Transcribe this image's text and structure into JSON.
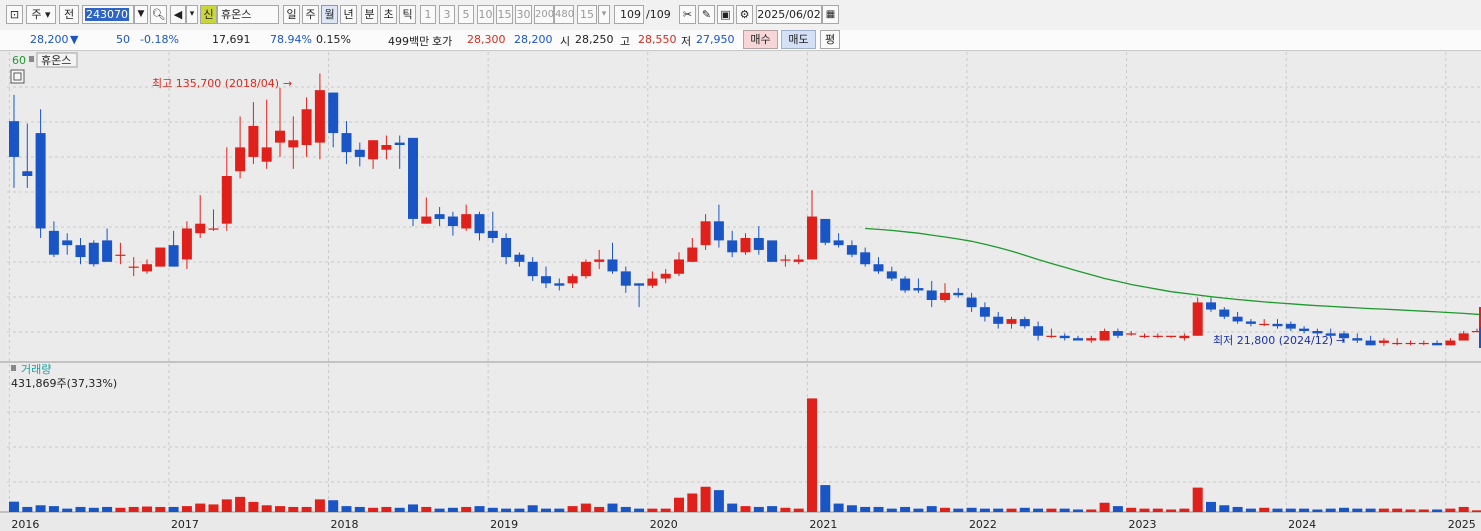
{
  "toolbar": {
    "stock_mode": "주",
    "prev_label": "전",
    "code": "243070",
    "sin_label": "신",
    "name": "휴온스",
    "periods": [
      "일",
      "주",
      "월",
      "년",
      "분",
      "초",
      "틱"
    ],
    "active_period": "월",
    "intervals": [
      "1",
      "3",
      "5",
      "10",
      "15",
      "30",
      "200",
      "480"
    ],
    "count": "15",
    "page": "109",
    "page_total": "/109",
    "date": "2025/06/02"
  },
  "quote": {
    "price": "28,200",
    "change_arrow": "▼",
    "change": "50",
    "change_pct": "-0.18%",
    "volume": "17,691",
    "vol_ratio": "78.94%",
    "turnover": "0.15%",
    "amount": "499백만",
    "hoga_label": "호가",
    "ask": "28,300",
    "bid": "28,200",
    "open_label": "시",
    "open": "28,250",
    "high_label": "고",
    "high": "28,550",
    "low_label": "저",
    "low": "27,950",
    "buy_label": "매수",
    "sell_label": "매도",
    "eval_label": "평"
  },
  "chart_data": {
    "type": "candlestick",
    "ma_label": "60",
    "name_tag": "휴온스",
    "ylim": [
      15000,
      145000
    ],
    "max_annotation": "최고 135,700 (2018/04)",
    "min_annotation": "최저 21,800 (2024/12)",
    "volume_label": "거래량",
    "volume_value": "431,869주(37,33%)",
    "volume_max": 1450000,
    "x_labels": [
      "2016",
      "2017",
      "2018",
      "2019",
      "2020",
      "2021",
      "2022",
      "2023",
      "2024",
      "2025"
    ],
    "x_label_months": [
      0,
      12,
      24,
      36,
      48,
      60,
      72,
      84,
      96,
      108
    ],
    "candles": [
      [
        116,
        127,
        101,
        88,
        123000
      ],
      [
        95,
        115,
        93,
        88,
        60000
      ],
      [
        111,
        121,
        71,
        67,
        80000
      ],
      [
        70,
        74,
        60,
        59,
        70000
      ],
      [
        66,
        69,
        64,
        60,
        40000
      ],
      [
        64,
        67,
        59,
        56,
        60000
      ],
      [
        65,
        66,
        56,
        55,
        50000
      ],
      [
        66,
        71,
        57,
        57,
        60000
      ],
      [
        60,
        65,
        60,
        56,
        50000
      ],
      [
        55,
        59,
        55,
        51,
        60000
      ],
      [
        53,
        58,
        56,
        52,
        65000
      ],
      [
        55,
        61,
        63,
        55,
        60000
      ],
      [
        64,
        70,
        55,
        55,
        60000
      ],
      [
        58,
        74,
        71,
        54,
        70000
      ],
      [
        69,
        85,
        73,
        67,
        100000
      ],
      [
        71,
        79,
        71,
        70,
        90000
      ],
      [
        73,
        105,
        93,
        70,
        150000
      ],
      [
        95,
        118,
        105,
        92,
        180000
      ],
      [
        101,
        124,
        114,
        98,
        120000
      ],
      [
        99,
        125,
        105,
        96,
        80000
      ],
      [
        107,
        130,
        112,
        101,
        70000
      ],
      [
        105,
        118,
        108,
        96,
        60000
      ],
      [
        106,
        126,
        121,
        101,
        60000
      ],
      [
        107,
        136,
        129,
        100,
        150000
      ],
      [
        128,
        126,
        111,
        105,
        140000
      ],
      [
        111,
        116,
        103,
        98,
        70000
      ],
      [
        104,
        107,
        101,
        97,
        60000
      ],
      [
        100,
        108,
        108,
        96,
        50000
      ],
      [
        104,
        110,
        106,
        100,
        60000
      ],
      [
        107,
        110,
        106,
        96,
        50000
      ],
      [
        109,
        107,
        75,
        72,
        90000
      ],
      [
        73,
        84,
        76,
        73,
        60000
      ],
      [
        77,
        80,
        75,
        72,
        40000
      ],
      [
        76,
        78,
        72,
        68,
        50000
      ],
      [
        71,
        81,
        77,
        70,
        60000
      ],
      [
        77,
        78,
        69,
        66,
        70000
      ],
      [
        70,
        78,
        67,
        65,
        50000
      ],
      [
        67,
        69,
        59,
        56,
        40000
      ],
      [
        60,
        61,
        57,
        55,
        40000
      ],
      [
        57,
        59,
        51,
        49,
        80000
      ],
      [
        51,
        55,
        48,
        46,
        40000
      ],
      [
        48,
        50,
        47,
        45,
        40000
      ],
      [
        48,
        52,
        51,
        46,
        70000
      ],
      [
        51,
        58,
        57,
        50,
        100000
      ],
      [
        57,
        62,
        58,
        54,
        60000
      ],
      [
        58,
        65,
        53,
        52,
        100000
      ],
      [
        53,
        55,
        47,
        44,
        60000
      ],
      [
        48,
        48,
        47,
        38,
        40000
      ],
      [
        47,
        53,
        50,
        46,
        40000
      ],
      [
        50,
        54,
        52,
        48,
        40000
      ],
      [
        52,
        61,
        58,
        51,
        170000
      ],
      [
        57,
        67,
        63,
        57,
        220000
      ],
      [
        64,
        77,
        74,
        62,
        300000
      ],
      [
        74,
        81,
        66,
        63,
        260000
      ],
      [
        66,
        70,
        61,
        59,
        100000
      ],
      [
        61,
        69,
        67,
        60,
        70000
      ],
      [
        67,
        72,
        62,
        60,
        60000
      ],
      [
        66,
        64,
        57,
        57,
        70000
      ],
      [
        58,
        60,
        58,
        55,
        50000
      ],
      [
        57,
        60,
        58,
        56,
        40000
      ],
      [
        58,
        87,
        76,
        58,
        1350000
      ],
      [
        75,
        75,
        65,
        64,
        320000
      ],
      [
        66,
        69,
        64,
        63,
        100000
      ],
      [
        64,
        66,
        60,
        59,
        80000
      ],
      [
        61,
        63,
        56,
        55,
        60000
      ],
      [
        56,
        59,
        53,
        52,
        60000
      ],
      [
        53,
        55,
        50,
        49,
        40000
      ],
      [
        50,
        51,
        45,
        44,
        60000
      ],
      [
        46,
        50,
        45,
        44,
        40000
      ],
      [
        45,
        49,
        41,
        38,
        70000
      ],
      [
        41,
        48,
        44,
        40,
        50000
      ],
      [
        44,
        46,
        43,
        42,
        40000
      ],
      [
        42,
        44,
        38,
        36,
        50000
      ],
      [
        38,
        40,
        34,
        32,
        40000
      ],
      [
        34,
        36,
        31,
        29,
        40000
      ],
      [
        31,
        34,
        33,
        29,
        40000
      ],
      [
        33,
        34,
        30,
        29,
        50000
      ],
      [
        30,
        32,
        26,
        24,
        40000
      ],
      [
        26,
        29,
        26,
        25,
        40000
      ],
      [
        26,
        27,
        25,
        24,
        40000
      ],
      [
        25,
        26,
        24,
        24,
        30000
      ],
      [
        24,
        26,
        25,
        23,
        30000
      ],
      [
        24,
        29,
        28,
        24,
        110000
      ],
      [
        28,
        29,
        26,
        25,
        70000
      ],
      [
        27,
        28,
        27,
        26,
        50000
      ],
      [
        26,
        27,
        26,
        25,
        40000
      ],
      [
        26,
        27,
        26,
        25,
        40000
      ],
      [
        26,
        26,
        26,
        25,
        30000
      ],
      [
        25,
        27,
        26,
        24,
        40000
      ],
      [
        26,
        42,
        40,
        26,
        290000
      ],
      [
        40,
        42,
        37,
        36,
        120000
      ],
      [
        37,
        38,
        34,
        33,
        80000
      ],
      [
        34,
        36,
        32,
        31,
        60000
      ],
      [
        32,
        33,
        31,
        30,
        40000
      ],
      [
        31,
        33,
        31,
        30,
        50000
      ],
      [
        31,
        33,
        30,
        29,
        40000
      ],
      [
        31,
        32,
        29,
        28,
        40000
      ],
      [
        29,
        30,
        28,
        27,
        40000
      ],
      [
        28,
        29,
        27,
        26,
        30000
      ],
      [
        27,
        29,
        26,
        25,
        40000
      ],
      [
        27,
        28,
        25,
        23,
        50000
      ],
      [
        25,
        27,
        24,
        23,
        40000
      ],
      [
        24,
        26,
        22,
        22,
        40000
      ],
      [
        23,
        25,
        24,
        21.8,
        40000
      ],
      [
        23,
        25,
        23,
        22,
        40000
      ],
      [
        23,
        24,
        23,
        22,
        30000
      ],
      [
        23,
        24,
        23,
        22,
        30000
      ],
      [
        23,
        24,
        22,
        22,
        30000
      ],
      [
        22,
        25,
        24,
        22,
        40000
      ],
      [
        24,
        28,
        27,
        24,
        60000
      ],
      [
        28,
        29,
        28,
        28,
        20000
      ]
    ],
    "ma_values": [
      [
        64,
        71
      ],
      [
        65,
        70.6
      ],
      [
        66,
        70.2
      ],
      [
        67,
        69.6
      ],
      [
        68,
        69.0
      ],
      [
        69,
        68.2
      ],
      [
        70,
        67.4
      ],
      [
        71,
        66.6
      ],
      [
        72,
        65.6
      ],
      [
        73,
        64.4
      ],
      [
        74,
        63.0
      ],
      [
        75,
        61.5
      ],
      [
        76,
        59.8
      ],
      [
        77,
        58.0
      ],
      [
        78,
        56.3
      ],
      [
        79,
        54.7
      ],
      [
        80,
        53.1
      ],
      [
        81,
        51.6
      ],
      [
        82,
        50.0
      ],
      [
        83,
        48.8
      ],
      [
        84,
        47.5
      ],
      [
        85,
        46.5
      ],
      [
        86,
        45.5
      ],
      [
        87,
        44.5
      ],
      [
        88,
        43.8
      ],
      [
        89,
        43.1
      ],
      [
        90,
        42.4
      ],
      [
        91,
        41.8
      ],
      [
        92,
        41.2
      ],
      [
        93,
        40.7
      ],
      [
        94,
        40.2
      ],
      [
        95,
        39.8
      ],
      [
        96,
        39.4
      ],
      [
        97,
        39.0
      ],
      [
        98,
        38.6
      ],
      [
        99,
        38.3
      ],
      [
        100,
        38.0
      ],
      [
        101,
        37.7
      ],
      [
        102,
        37.4
      ],
      [
        103,
        37.2
      ],
      [
        104,
        36.9
      ],
      [
        105,
        36.6
      ],
      [
        106,
        36.3
      ],
      [
        107,
        36.0
      ],
      [
        108,
        35.7
      ],
      [
        109,
        35.4
      ],
      [
        110,
        35.0
      ],
      [
        111,
        34.6
      ]
    ]
  },
  "colors": {
    "up": "#e0201a",
    "down": "#1a55c6",
    "ma": "#1e9a2e",
    "grid": "#c9c9c9",
    "background": "#e9e9e9"
  }
}
